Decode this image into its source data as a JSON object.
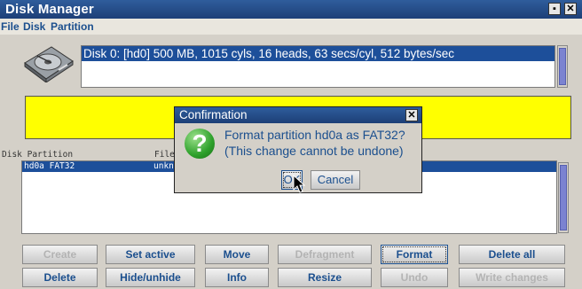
{
  "window": {
    "title": "Disk Manager",
    "restore_glyph": "▪",
    "close_glyph": "✕"
  },
  "menu": {
    "items": [
      "File",
      "Disk",
      "Partition"
    ]
  },
  "disks": {
    "rows": [
      "Disk 0: [hd0] 500 MB, 1015 cyls, 16 heads, 63 secs/cyl, 512 bytes/sec"
    ],
    "icon": "hard-disk-icon"
  },
  "partitions": {
    "headers": [
      "Disk Partition",
      "File"
    ],
    "rows": [
      {
        "partition": "hd0a FAT32",
        "file": "unkn"
      }
    ]
  },
  "buttons": {
    "row1": [
      "Create",
      "Set active",
      "Move",
      "Defragment",
      "Format",
      "Delete all"
    ],
    "row2": [
      "Delete",
      "Hide/unhide",
      "Info",
      "Resize",
      "Undo",
      "Write changes"
    ]
  },
  "dialog": {
    "title": "Confirmation",
    "close_glyph": "✕",
    "icon": "question-icon",
    "icon_glyph": "?",
    "line1": "Format partition hd0a as FAT32?",
    "line2": "(This change cannot be undone)",
    "ok_label": "OK",
    "cancel_label": "Cancel"
  },
  "colors": {
    "titlebar": "#1d3f77",
    "selection": "#1d4f9a",
    "warning_area": "#ffff00",
    "button_text": "#1b4f8e"
  }
}
